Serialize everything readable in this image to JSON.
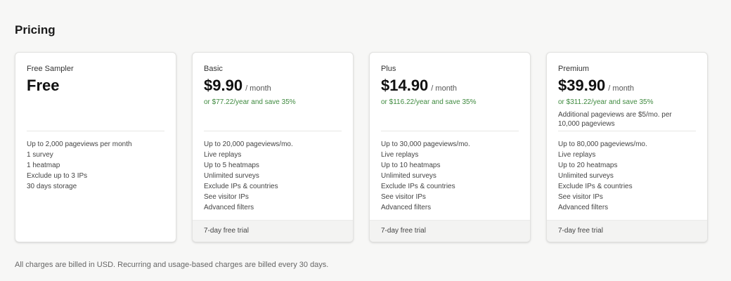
{
  "page": {
    "title": "Pricing",
    "footnote": "All charges are billed in USD. Recurring and usage-based charges are billed every 30 days."
  },
  "colors": {
    "background": "#f7f7f6",
    "card": "#ffffff",
    "savings_text": "#3f8a3f",
    "trial_footer": "#f3f3f2"
  },
  "plans": [
    {
      "name": "Free Sampler",
      "price": "Free",
      "per": "",
      "yearly": "",
      "extra": "",
      "features": [
        "Up to 2,000 pageviews per month",
        "1 survey",
        "1 heatmap",
        "Exclude up to 3 IPs",
        "30 days storage"
      ],
      "trial": ""
    },
    {
      "name": "Basic",
      "price": "$9.90",
      "per": "/ month",
      "yearly": "or $77.22/year and save 35%",
      "extra": "",
      "features": [
        "Up to 20,000 pageviews/mo.",
        "Live replays",
        "Up to 5 heatmaps",
        "Unlimited surveys",
        "Exclude IPs & countries",
        "See visitor IPs",
        "Advanced filters"
      ],
      "trial": "7-day free trial"
    },
    {
      "name": "Plus",
      "price": "$14.90",
      "per": "/ month",
      "yearly": "or $116.22/year and save 35%",
      "extra": "",
      "features": [
        "Up to 30,000 pageviews/mo.",
        "Live replays",
        "Up to 10 heatmaps",
        "Unlimited surveys",
        "Exclude IPs & countries",
        "See visitor IPs",
        "Advanced filters"
      ],
      "trial": "7-day free trial"
    },
    {
      "name": "Premium",
      "price": "$39.90",
      "per": "/ month",
      "yearly": "or $311.22/year and save 35%",
      "extra": "Additional pageviews are $5/mo. per 10,000 pageviews",
      "features": [
        "Up to 80,000 pageviews/mo.",
        "Live replays",
        "Up to 20 heatmaps",
        "Unlimited surveys",
        "Exclude IPs & countries",
        "See visitor IPs",
        "Advanced filters"
      ],
      "trial": "7-day free trial"
    }
  ]
}
